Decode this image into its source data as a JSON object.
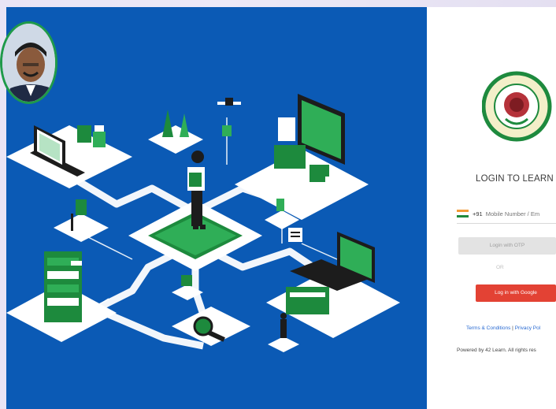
{
  "login": {
    "title": "LOGIN TO LEARN",
    "country_code": "+91",
    "phone_placeholder": "Mobile Number / Em",
    "otp_button": "Login with OTP",
    "or_label": "OR",
    "google_button": "Log in with Google",
    "terms_link": "Terms & Conditions",
    "privacy_link": "Privacy Pol",
    "separator": "|",
    "footer": "Powered by 42 Learn. All rights res"
  },
  "logo": {
    "university_text": "JAWAHARLAL NEHRU TECHNOLOGICAL UNIVERSITY",
    "city": "KAKINADA",
    "telugu": "సహ విద్యా వీయతాం"
  },
  "colors": {
    "hero_bg": "#0b5ab5",
    "accent_green": "#1e8a3e",
    "google_red": "#e34234",
    "link_blue": "#2a6bd2"
  }
}
